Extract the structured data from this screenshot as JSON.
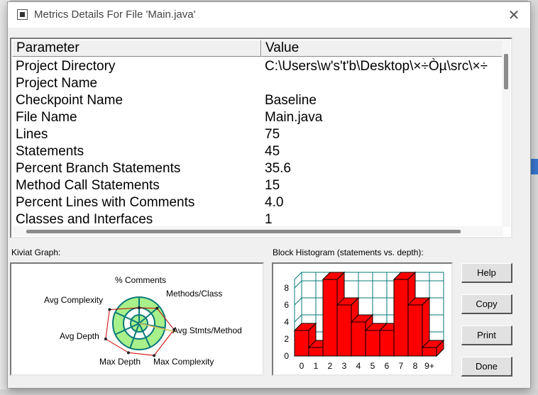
{
  "window": {
    "title": "Metrics Details For File 'Main.java'",
    "close_glyph": "✕"
  },
  "table": {
    "columns": [
      "Parameter",
      "Value"
    ],
    "rows": [
      {
        "parameter": "Project Directory",
        "value": "C:\\Users\\w's't'b\\Desktop\\×÷Òµ\\src\\×÷"
      },
      {
        "parameter": "Project Name",
        "value": ""
      },
      {
        "parameter": "Checkpoint Name",
        "value": "Baseline"
      },
      {
        "parameter": "File Name",
        "value": "Main.java"
      },
      {
        "parameter": "Lines",
        "value": "75"
      },
      {
        "parameter": "Statements",
        "value": "45"
      },
      {
        "parameter": "Percent Branch Statements",
        "value": "35.6"
      },
      {
        "parameter": "Method Call Statements",
        "value": "15"
      },
      {
        "parameter": "Percent Lines with Comments",
        "value": "4.0"
      },
      {
        "parameter": "Classes and Interfaces",
        "value": "1"
      }
    ]
  },
  "kiviat": {
    "label": "Kiviat Graph:",
    "axes": [
      "% Comments",
      "Methods/Class",
      "Avg Stmts/Method",
      "Max Complexity",
      "Max Depth",
      "Avg Depth",
      "Avg Complexity"
    ],
    "colors": {
      "band": "#a8f08a",
      "ring": "#0a7a7a",
      "outline": "#cc0000"
    }
  },
  "histogram": {
    "label": "Block Histogram (statements vs. depth):",
    "colors": {
      "bar": "#ff0000",
      "grid": "#0a7a7a"
    }
  },
  "chart_data": {
    "type": "bar",
    "categories": [
      "0",
      "1",
      "2",
      "3",
      "4",
      "5",
      "6",
      "7",
      "8",
      "9+"
    ],
    "values": [
      3,
      1,
      9,
      6,
      4,
      3,
      3,
      9,
      6,
      1
    ],
    "ylim": [
      0,
      9
    ],
    "yticks": [
      "0",
      "2",
      "4",
      "6",
      "8"
    ],
    "grid": true
  },
  "buttons": {
    "help": "Help",
    "copy": "Copy",
    "print": "Print",
    "done": "Done"
  }
}
